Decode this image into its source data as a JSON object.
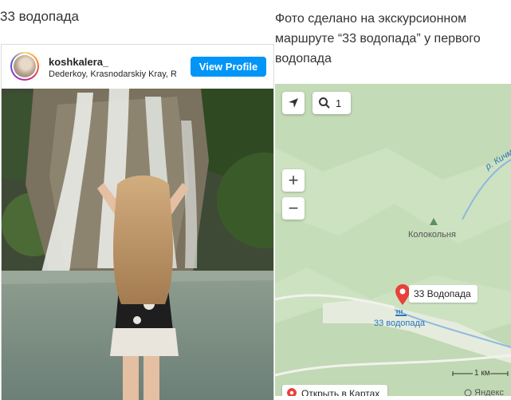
{
  "left_caption": "33 водопада",
  "right_caption": "Фото сделано на экскурсионном маршруте “33 водопада” у первого водопада",
  "instagram": {
    "username": "koshkalera_",
    "location": "Dederkoy, Krasnodarskiy Kray, Russia",
    "view_profile_label": "View Profile"
  },
  "map": {
    "search_count": "1",
    "zoom_in": "+",
    "zoom_out": "−",
    "poi_bell_label": "Колокольня",
    "river_label": "р. Кичм",
    "pin_callout": "33 Водопада",
    "waterfall_label": "33 водопада",
    "scale_label": "1 км",
    "open_in_maps": "Открыть в Картах",
    "logo_text": "Яндекс",
    "accent_red": "#e8413a",
    "water_blue": "#2a76c0"
  }
}
